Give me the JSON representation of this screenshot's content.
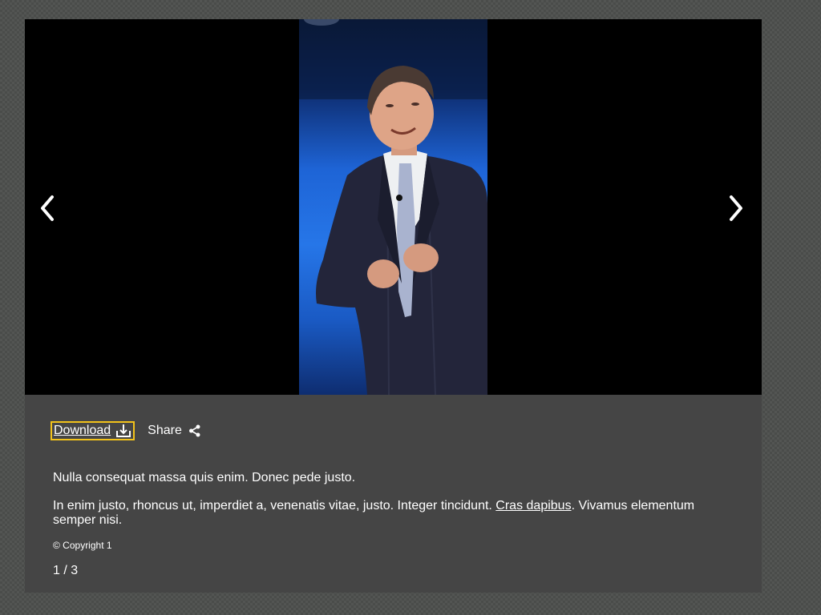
{
  "colors": {
    "page_background": "#4a4c4a",
    "panel_background": "#454545",
    "stage_background": "#000000",
    "focus_outline": "#f2c21b",
    "text": "#ffffff"
  },
  "gallery": {
    "prev_icon": "chevron-left-icon",
    "next_icon": "chevron-right-icon",
    "image_icon": "photo-of-speaker-on-stage"
  },
  "actions": {
    "download_label": "Download",
    "download_icon": "download-icon",
    "share_label": "Share",
    "share_icon": "share-icon"
  },
  "caption": {
    "line1": "Nulla consequat massa quis enim. Donec pede justo.",
    "line2_before_link": "In enim justo, rhoncus ut, imperdiet a, venenatis vitae, justo. Integer tincidunt. ",
    "line2_link": "Cras dapibus",
    "line2_after_link": ". Vivamus elementum semper nisi.",
    "copyright": "© Copyright 1"
  },
  "pagination": {
    "counter": "1 / 3"
  }
}
